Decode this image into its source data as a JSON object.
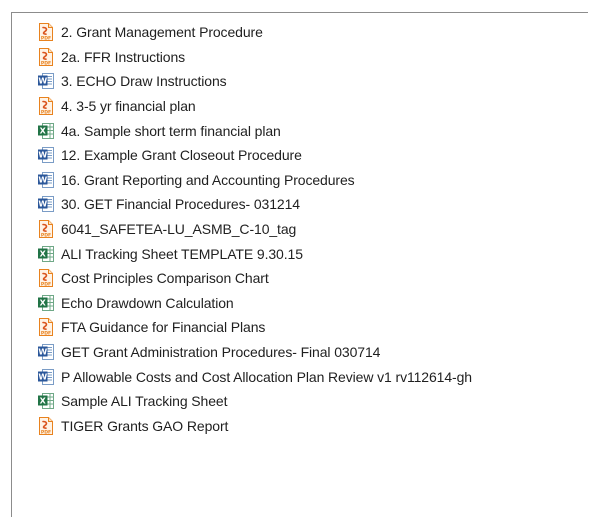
{
  "files": [
    {
      "name": "2. Grant Management Procedure",
      "icon": "pdf-file-icon"
    },
    {
      "name": "2a. FFR Instructions",
      "icon": "pdf-file-icon"
    },
    {
      "name": "3. ECHO Draw Instructions",
      "icon": "word-file-icon"
    },
    {
      "name": "4. 3-5 yr financial plan",
      "icon": "pdf-file-icon"
    },
    {
      "name": "4a. Sample short term financial plan",
      "icon": "excel-file-icon"
    },
    {
      "name": "12. Example Grant Closeout Procedure",
      "icon": "word-file-icon"
    },
    {
      "name": "16. Grant Reporting and Accounting Procedures",
      "icon": "word-file-icon"
    },
    {
      "name": "30. GET Financial Procedures- 031214",
      "icon": "word-file-icon"
    },
    {
      "name": "6041_SAFETEA-LU_ASMB_C-10_tag",
      "icon": "pdf-file-icon"
    },
    {
      "name": "ALI Tracking Sheet TEMPLATE 9.30.15",
      "icon": "excel-file-icon"
    },
    {
      "name": "Cost Principles Comparison Chart",
      "icon": "pdf-file-icon"
    },
    {
      "name": "Echo Drawdown Calculation",
      "icon": "excel-file-icon"
    },
    {
      "name": "FTA Guidance for Financial Plans",
      "icon": "pdf-file-icon"
    },
    {
      "name": "GET Grant Administration Procedures- Final 030714",
      "icon": "word-file-icon"
    },
    {
      "name": "P  Allowable Costs and Cost Allocation Plan Review v1 rv112614-gh",
      "icon": "word-file-icon"
    },
    {
      "name": "Sample ALI Tracking Sheet",
      "icon": "excel-file-icon"
    },
    {
      "name": "TIGER Grants GAO Report",
      "icon": "pdf-file-icon"
    }
  ],
  "colors": {
    "pdf_accent": "#e8821e",
    "word_accent": "#2b579a",
    "excel_accent": "#217346",
    "border": "#8c8c8c"
  }
}
